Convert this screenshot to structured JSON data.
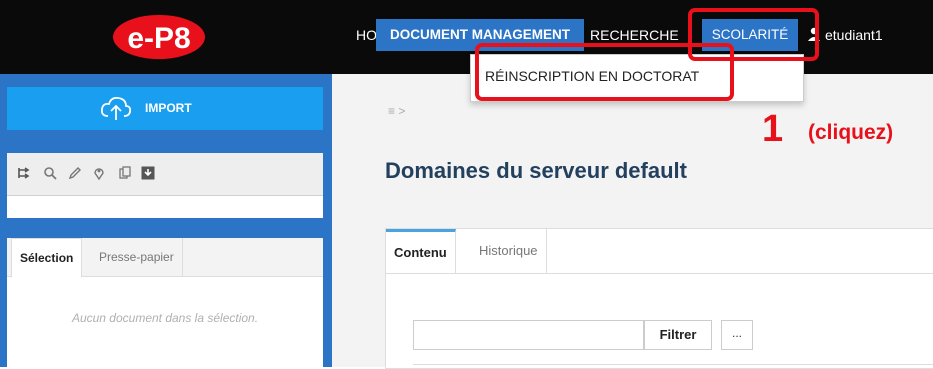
{
  "brand": {
    "logo_text": "e-P8",
    "colors": {
      "logo_red": "#e8111b",
      "accent": "#2c74c6"
    }
  },
  "nav": {
    "home": "HOME",
    "document_management": "DOCUMENT MANAGEMENT",
    "recherche": "RECHERCHE",
    "scolarite": "SCOLARITÉ",
    "user": "etudiant1"
  },
  "dropdown": {
    "item": "RÉINSCRIPTION EN DOCTORAT"
  },
  "sidebar": {
    "import_label": "IMPORT",
    "toolbar_icons": [
      "tree-icon",
      "search-icon",
      "edit-icon",
      "location-icon",
      "copy-icon",
      "download-icon"
    ],
    "panel_tabs": [
      "Sélection",
      "Presse-papier"
    ],
    "empty_message": "Aucun document dans la sélection."
  },
  "main": {
    "breadcrumb": "≡ >",
    "title": "Domaines du serveur default",
    "tabs": [
      "Contenu",
      "Historique"
    ],
    "filter_button": "Filtrer",
    "more_button": "..."
  },
  "annotation": {
    "step": "1",
    "instruction": "(cliquez)",
    "color": "#e8111b"
  }
}
